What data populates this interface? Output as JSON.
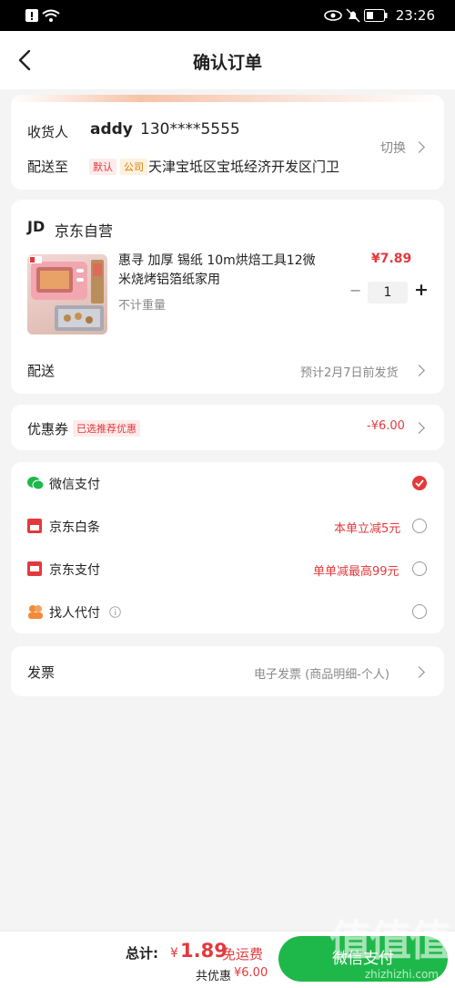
{
  "status_bar": {
    "time": "23:26"
  },
  "header": {
    "title": "确认订单"
  },
  "address": {
    "receiver_label": "收货人",
    "receiver_name": "addy",
    "receiver_phone": "130****5555",
    "switch_label": "切换",
    "deliver_to_label": "配送至",
    "tag_default": "默认",
    "tag_company": "公司",
    "address_text": "天津宝坻区宝坻经济开发区门卫"
  },
  "store": {
    "logo_text": "JD",
    "name": "京东自营",
    "product": {
      "title_line1": "惠寻 加厚 锡纸 10m烘焙工具12微",
      "title_line2": "米烧烤铝箔纸家用",
      "weight_note": "不计重量",
      "price": "¥7.89",
      "quantity": "1",
      "minus": "−",
      "plus": "+"
    },
    "delivery_label": "配送",
    "delivery_value": "预计2月7日前发货"
  },
  "coupon": {
    "label": "优惠券",
    "badge": "已选推荐优惠",
    "value": "-¥6.00"
  },
  "payment": {
    "methods": [
      {
        "name": "微信支付",
        "promo": "",
        "checked": true,
        "icon": "wechat-icon",
        "color": "#1eb84a"
      },
      {
        "name": "京东白条",
        "promo": "本单立减5元",
        "checked": false,
        "icon": "baitiao-icon",
        "color": "#e4393c"
      },
      {
        "name": "京东支付",
        "promo": "单单减最高99元",
        "checked": false,
        "icon": "jdpay-icon",
        "color": "#e4393c"
      },
      {
        "name": "找人代付",
        "promo": "",
        "checked": false,
        "icon": "friends-pay-icon",
        "color": "#f08b38"
      }
    ]
  },
  "invoice": {
    "label": "发票",
    "value": "电子发票 (商品明细-个人)"
  },
  "footer": {
    "total_label": "总计:",
    "total_currency": "¥",
    "total_value": "1.89",
    "shipping_note": "免运费",
    "discount_label": "共优惠",
    "discount_value": "¥6.00",
    "pay_button": "微信支付"
  },
  "watermark": {
    "big": "值值值",
    "small": "zhizhizhi.com"
  },
  "colors": {
    "accent": "#e4393c",
    "wechat_green": "#1eb84a",
    "background": "#f4f4f4"
  }
}
